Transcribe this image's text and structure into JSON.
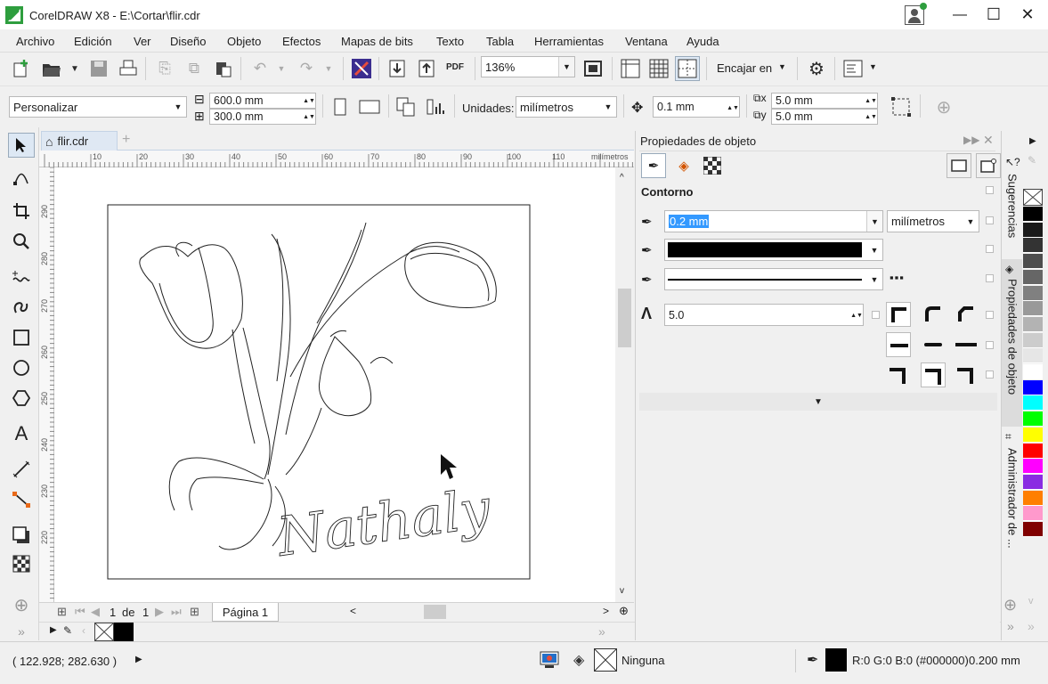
{
  "window": {
    "title": "CorelDRAW X8 - E:\\Cortar\\flir.cdr",
    "minimize": "—",
    "maximize": "☐",
    "close": "✕"
  },
  "menu": [
    "Archivo",
    "Edición",
    "Ver",
    "Diseño",
    "Objeto",
    "Efectos",
    "Mapas de bits",
    "Texto",
    "Tabla",
    "Herramientas",
    "Ventana",
    "Ayuda"
  ],
  "toolbar1": {
    "zoom": "136%",
    "snap": "Encajar en",
    "pdf_label": "PDF"
  },
  "toolbar2": {
    "page_preset": "Personalizar",
    "width": "600.0 mm",
    "height": "300.0 mm",
    "units_label": "Unidades:",
    "units_value": "milímetros",
    "nudge": "0.1 mm",
    "dup_x": "5.0 mm",
    "dup_y": "5.0 mm"
  },
  "document": {
    "tab_name": "flir.cdr",
    "ruler_h_labels": [
      "10",
      "20",
      "30",
      "40",
      "50",
      "60",
      "70",
      "80",
      "90",
      "100",
      "110"
    ],
    "ruler_h_unit": "milímetros",
    "ruler_v_labels": [
      "290",
      "280",
      "270",
      "260",
      "250",
      "240",
      "230",
      "220"
    ],
    "signature": "Nathaly"
  },
  "pagenav": {
    "current": "1",
    "of": "de",
    "total": "1",
    "page_tab": "Página 1"
  },
  "docker": {
    "title": "Propiedades de objeto",
    "section": "Contorno",
    "width_value": "0.2 mm",
    "width_units": "milímetros",
    "miter_value": "5.0"
  },
  "vtabs": {
    "tab1": "Sugerencias",
    "tab2": "Propiedades de objeto",
    "tab3": "Administrador de ..."
  },
  "palette_colors": [
    "#000000",
    "#1a1a1a",
    "#333333",
    "#4d4d4d",
    "#666666",
    "#808080",
    "#999999",
    "#b3b3b3",
    "#cccccc",
    "#e6e6e6",
    "#ffffff",
    "#0000ff",
    "#00ffff",
    "#00ff00",
    "#ffff00",
    "#ff0000",
    "#ff00ff",
    "#8a2be2",
    "#ff7f00",
    "#ff99cc",
    "#800000"
  ],
  "status": {
    "coords": "( 122.928; 282.630 )",
    "fill": "Ninguna",
    "outline_color": "R:0 G:0 B:0 (#000000)",
    "outline_width": "0.200 mm"
  }
}
